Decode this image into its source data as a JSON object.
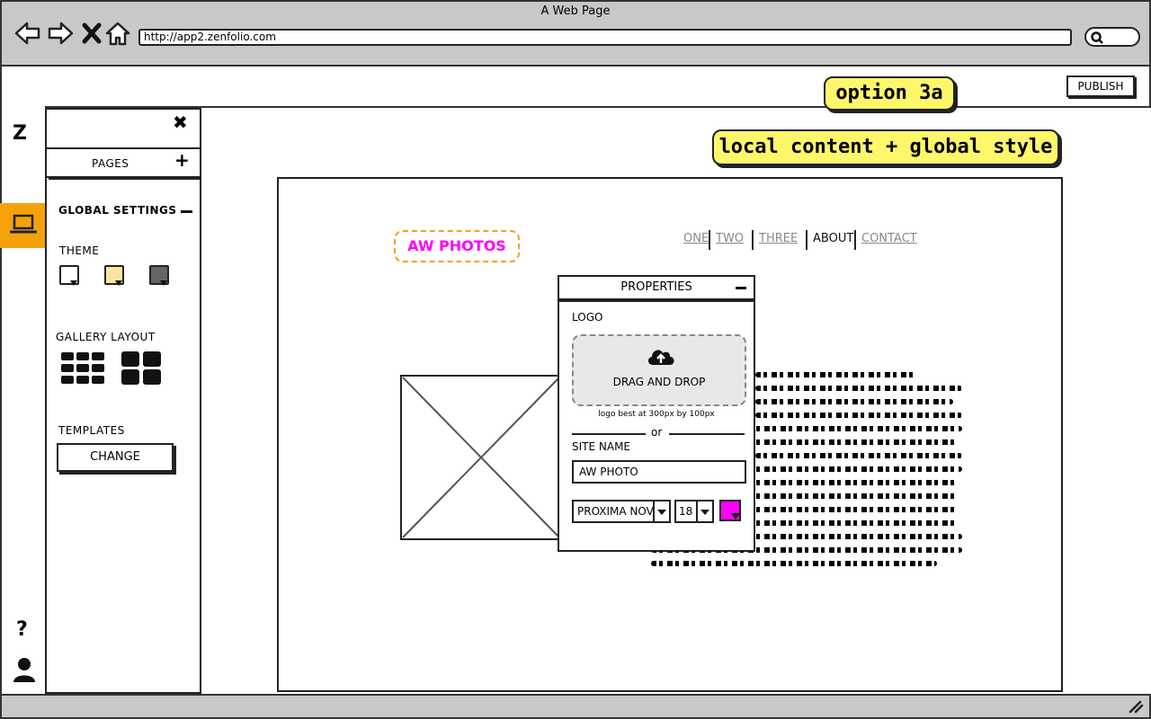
{
  "browser": {
    "window_title": "A Web Page",
    "url": "http://app2.zenfolio.com",
    "nav_icons": [
      "back-arrow-icon",
      "forward-arrow-icon",
      "stop-x-icon",
      "home-icon"
    ]
  },
  "topbar": {
    "publish_label": "PUBLISH"
  },
  "annotations": {
    "option_label": "option 3a",
    "note_label": "local content + global style"
  },
  "rail": {
    "logo": "Z",
    "help": "?"
  },
  "panel": {
    "close_icon": "✖",
    "pages_label": "PAGES",
    "add_icon": "+",
    "global_settings_label": "GLOBAL SETTINGS",
    "collapse_icon": "—",
    "theme_label": "THEME",
    "themes": [
      {
        "name": "white",
        "color": "#ffffff"
      },
      {
        "name": "cream",
        "color": "#fbe3a0"
      },
      {
        "name": "dark",
        "color": "#666666"
      }
    ],
    "gallery_layout_label": "GALLERY LAYOUT",
    "templates_label": "TEMPLATES",
    "change_label": "CHANGE"
  },
  "site": {
    "logo_text": "AW PHOTOS",
    "logo_color": "#ff00ff",
    "nav": [
      {
        "label": "ONE",
        "active": false
      },
      {
        "label": "TWO",
        "active": false
      },
      {
        "label": "THREE",
        "active": false
      },
      {
        "label": "ABOUT",
        "active": true
      },
      {
        "label": "CONTACT",
        "active": false
      }
    ]
  },
  "properties": {
    "title": "PROPERTIES",
    "collapse_icon": "—",
    "logo_label": "LOGO",
    "drop_label": "DRAG AND DROP",
    "hint": "logo best at 300px by 100px",
    "or_label": "or",
    "site_name_label": "SITE NAME",
    "site_name_value": "AW PHOTO",
    "font_value": "PROXIMA NOVA",
    "size_value": "18",
    "color_value": "#ff00ff"
  }
}
